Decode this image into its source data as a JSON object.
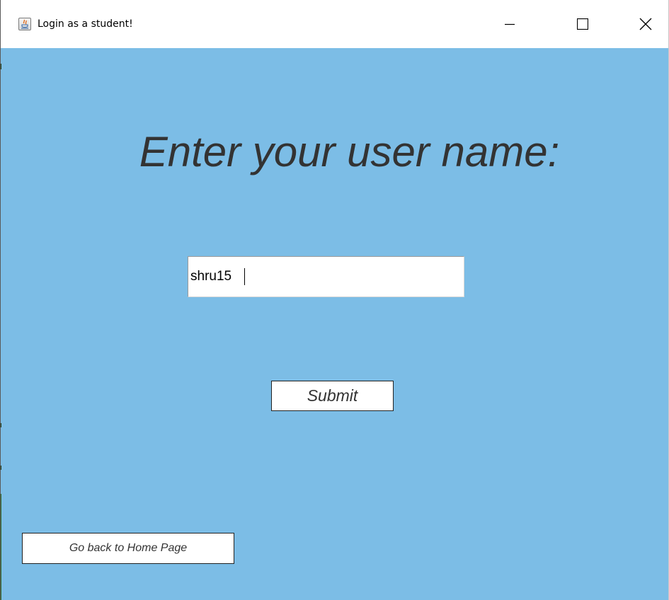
{
  "window": {
    "title": "Login as a student!",
    "app_icon": "java-icon",
    "controls": {
      "minimize_icon": "minimize-icon",
      "maximize_icon": "maximize-icon",
      "close_icon": "close-icon"
    }
  },
  "content": {
    "background_color": "#7cbde6",
    "heading": "Enter your user name:",
    "username_input": {
      "value": "shru15",
      "placeholder": ""
    },
    "submit_label": "Submit",
    "home_label": "Go back to Home Page"
  }
}
